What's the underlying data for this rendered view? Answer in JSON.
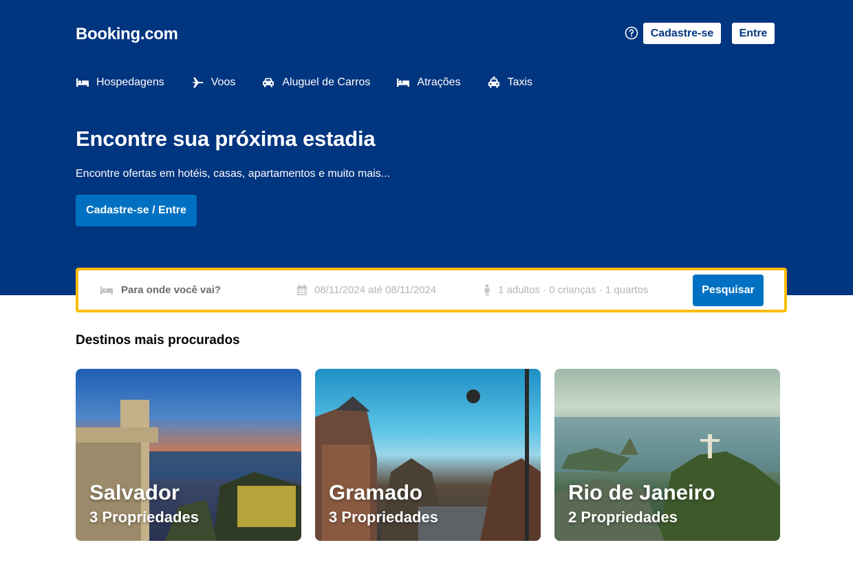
{
  "header": {
    "brand": "Booking.com",
    "register_label": "Cadastre-se",
    "login_label": "Entre",
    "help_icon": "question-circle-icon"
  },
  "nav": {
    "items": [
      {
        "label": "Hospedagens",
        "icon": "bed-icon"
      },
      {
        "label": "Voos",
        "icon": "plane-icon"
      },
      {
        "label": "Aluguel de Carros",
        "icon": "car-icon"
      },
      {
        "label": "Atrações",
        "icon": "bed-icon"
      },
      {
        "label": "Taxis",
        "icon": "taxi-icon"
      }
    ]
  },
  "hero": {
    "title": "Encontre sua próxima estadia",
    "subtitle": "Encontre ofertas em hotéis, casas, apartamentos e muito mais...",
    "cta_label": "Cadastre-se / Entre"
  },
  "search": {
    "destination_placeholder": "Para onde você vai?",
    "dates": "08/11/2024 até 08/11/2024",
    "guests": "1 adultos · 0 crianças · 1 quartos",
    "button_label": "Pesquisar"
  },
  "popular": {
    "title": "Destinos mais procurados",
    "destinations": [
      {
        "name": "Salvador",
        "count": "3 Propriedades"
      },
      {
        "name": "Gramado",
        "count": "3 Propriedades"
      },
      {
        "name": "Rio de Janeiro",
        "count": "2 Propriedades"
      }
    ]
  },
  "colors": {
    "brand_blue": "#003580",
    "action_blue": "#0071c2",
    "search_border": "#febb02"
  }
}
